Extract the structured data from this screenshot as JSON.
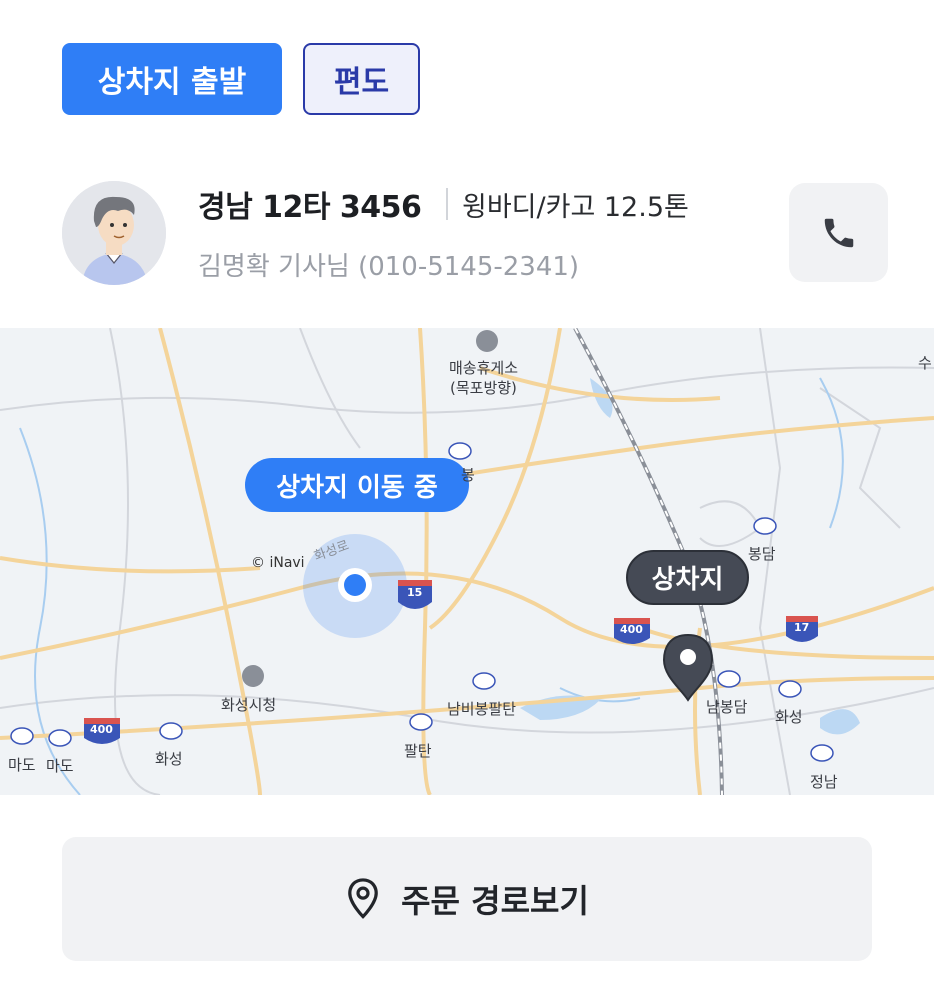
{
  "tags": {
    "primary": "상차지 출발",
    "secondary": "편도"
  },
  "vehicle": {
    "plate": "경남 12타 3456",
    "type": "윙바디/카고 12.5톤",
    "driver": "김명확 기사님 (010-5145-2341)"
  },
  "map": {
    "moving_label": "상차지 이동 중",
    "destination_label": "상차지",
    "credit": "© iNavi",
    "labels": {
      "rest_area_1": "매송휴게소",
      "rest_area_2": "(목포방향)",
      "hwaseong_road": "화성로",
      "hwaseong_city_hall": "화성시청",
      "nambi_bongpaltan": "남비봉팔탄",
      "paltan": "팔탄",
      "hwaseong_1": "화성",
      "hwaseong_2": "화성",
      "mado_1": "마도",
      "mado_2": "마도",
      "bongdam": "봉담",
      "nambongdam": "남봉담",
      "jeongnam": "정남",
      "bong": "봉",
      "su": "수"
    },
    "shields": {
      "r15": "15",
      "r400a": "400",
      "r400b": "400",
      "r17": "17"
    },
    "colors": {
      "accent": "#2f7ef6",
      "pin": "#454a55"
    }
  },
  "actions": {
    "route_label": "주문 경로보기"
  },
  "icons": {
    "phone": "phone-icon",
    "location": "location-pin-icon"
  }
}
